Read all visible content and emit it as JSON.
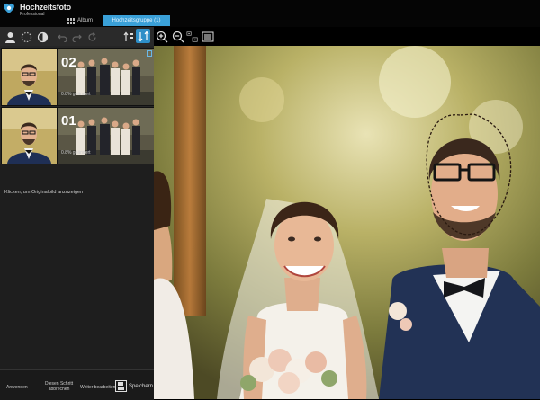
{
  "brand": {
    "name": "Hochzeitsfoto",
    "edition": "Professional"
  },
  "tabs": [
    {
      "label": "Album"
    },
    {
      "label": "Hochzeitsgruppe (1)"
    }
  ],
  "thumbnails": [
    {
      "number": "02",
      "status": "0.8% geändert"
    },
    {
      "number": "01",
      "status": "0.8% geändert"
    }
  ],
  "hint": "Klicken, um Originalbild anzuzeigen",
  "bottom_buttons": {
    "apply": "Anwenden",
    "cancel_line1": "Diesen Schritt",
    "cancel_line2": "abbrechen",
    "continue": "Weiter bearbeiten",
    "save": "Speichern"
  },
  "colors": {
    "accent": "#3aa0d8",
    "panel": "#1e1e1e",
    "toolbar": "#2a2a2a"
  },
  "icons": [
    "logo-heart-icon",
    "grid-icon",
    "person-icon",
    "lasso-icon",
    "compare-icon",
    "undo-icon",
    "redo-icon",
    "reset-icon",
    "sort-asc-icon",
    "sort-desc-icon",
    "zoom-in-icon",
    "zoom-out-icon",
    "actual-size-icon",
    "fit-screen-icon",
    "save-icon"
  ]
}
